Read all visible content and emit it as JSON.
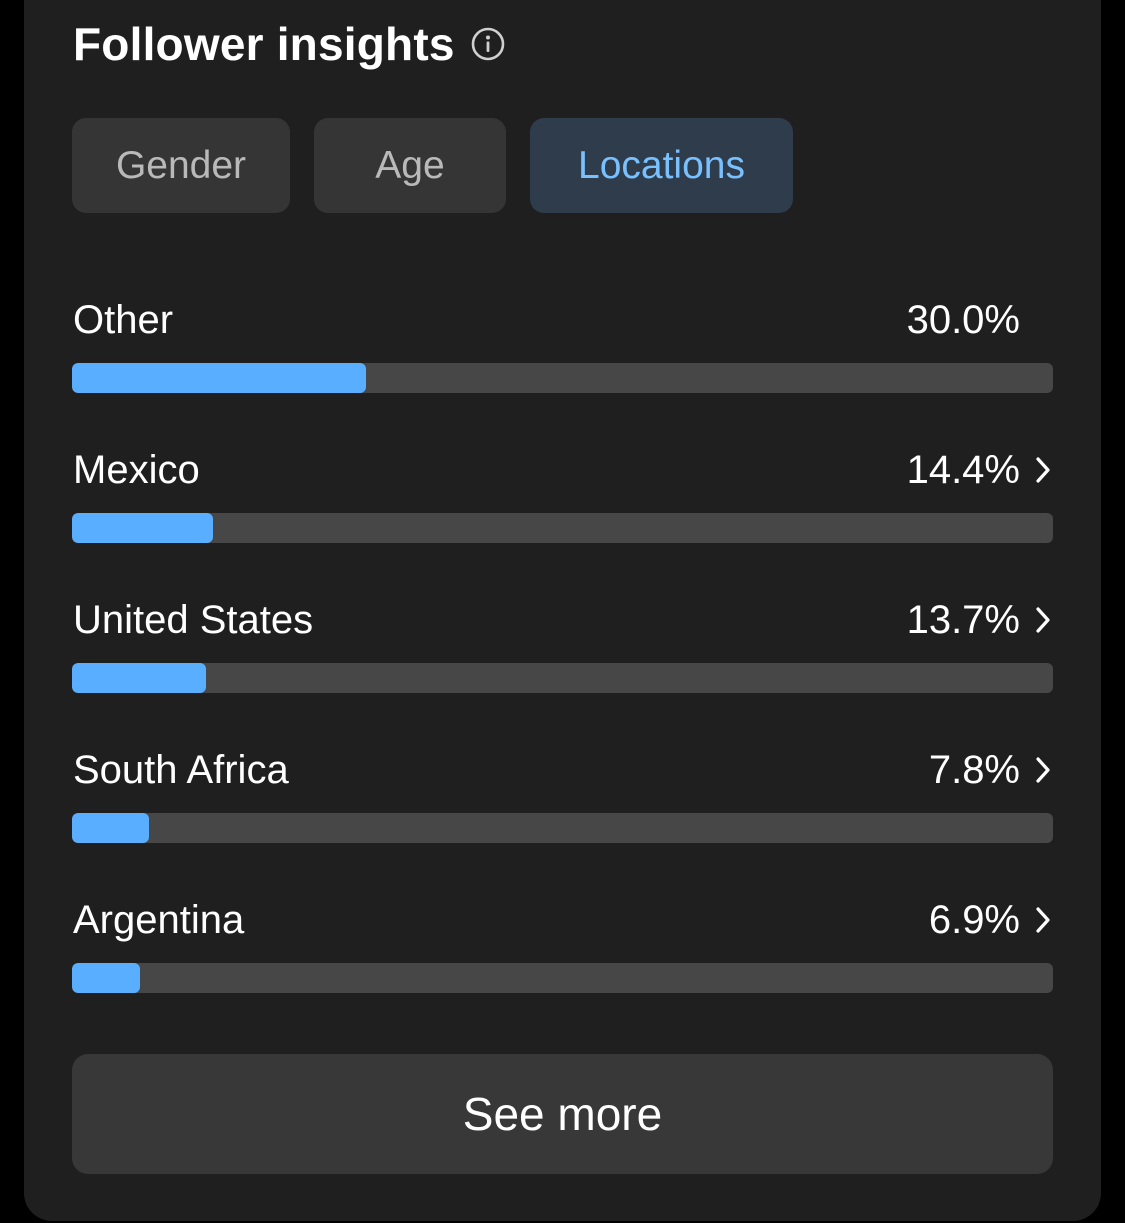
{
  "header": {
    "title": "Follower insights",
    "info_icon": "info-circle-icon"
  },
  "tabs": [
    {
      "label": "Gender",
      "selected": false
    },
    {
      "label": "Age",
      "selected": false
    },
    {
      "label": "Locations",
      "selected": true
    }
  ],
  "locations": [
    {
      "name": "Other",
      "percent_label": "30.0%",
      "value": 30.0,
      "has_chevron": false
    },
    {
      "name": "Mexico",
      "percent_label": "14.4%",
      "value": 14.4,
      "has_chevron": true
    },
    {
      "name": "United States",
      "percent_label": "13.7%",
      "value": 13.7,
      "has_chevron": true
    },
    {
      "name": "South Africa",
      "percent_label": "7.8%",
      "value": 7.8,
      "has_chevron": true
    },
    {
      "name": "Argentina",
      "percent_label": "6.9%",
      "value": 6.9,
      "has_chevron": true
    }
  ],
  "see_more_label": "See more",
  "colors": {
    "accent": "#5aaeff",
    "selected_tab_text": "#79c0ff",
    "card_bg": "#1f1f1f",
    "track": "#474747"
  }
}
